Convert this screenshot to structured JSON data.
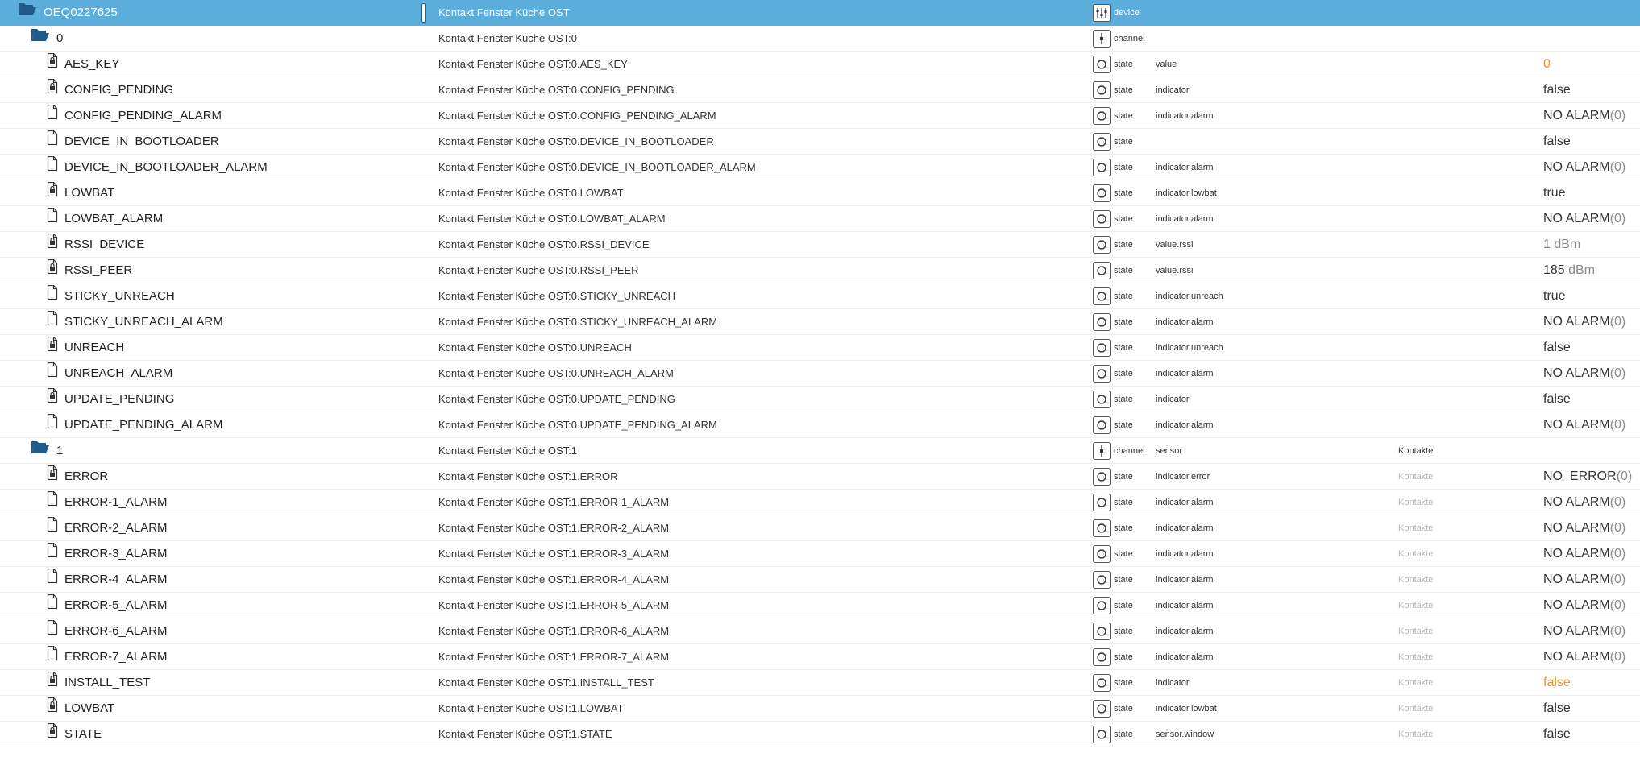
{
  "columns": {
    "sep": ""
  },
  "rows": [
    {
      "kind": "device",
      "level": 0,
      "icon": "folder-open-icon",
      "id": "OEQ0227625",
      "name": "Kontakt Fenster Küche OST",
      "type_icon": "device-icon",
      "type": "device",
      "role": "",
      "room": "",
      "value": "",
      "value_style": "",
      "selected": true
    },
    {
      "kind": "channel",
      "level": 1,
      "icon": "folder-open-icon",
      "id": "0",
      "name": "Kontakt Fenster Küche OST:0",
      "type_icon": "channel-icon",
      "type": "channel",
      "role": "",
      "room": "",
      "value": "",
      "value_style": ""
    },
    {
      "kind": "state",
      "level": 2,
      "icon": "file-lock-icon",
      "id": "AES_KEY",
      "name": "Kontakt Fenster Küche OST:0.AES_KEY",
      "type_icon": "state-icon",
      "type": "state",
      "role": "value",
      "room": "",
      "value": "0",
      "value_style": "orange"
    },
    {
      "kind": "state",
      "level": 2,
      "icon": "file-lock-icon",
      "id": "CONFIG_PENDING",
      "name": "Kontakt Fenster Küche OST:0.CONFIG_PENDING",
      "type_icon": "state-icon",
      "type": "state",
      "role": "indicator",
      "room": "",
      "value": "false",
      "value_style": ""
    },
    {
      "kind": "state",
      "level": 2,
      "icon": "file-icon",
      "id": "CONFIG_PENDING_ALARM",
      "name": "Kontakt Fenster Küche OST:0.CONFIG_PENDING_ALARM",
      "type_icon": "state-icon",
      "type": "state",
      "role": "indicator.alarm",
      "room": "",
      "value": "NO ALARM",
      "unit": "(0)",
      "value_style": ""
    },
    {
      "kind": "state",
      "level": 2,
      "icon": "file-icon",
      "id": "DEVICE_IN_BOOTLOADER",
      "name": "Kontakt Fenster Küche OST:0.DEVICE_IN_BOOTLOADER",
      "type_icon": "state-icon",
      "type": "state",
      "role": "",
      "room": "",
      "value": "false",
      "value_style": ""
    },
    {
      "kind": "state",
      "level": 2,
      "icon": "file-icon",
      "id": "DEVICE_IN_BOOTLOADER_ALARM",
      "name": "Kontakt Fenster Küche OST:0.DEVICE_IN_BOOTLOADER_ALARM",
      "type_icon": "state-icon",
      "type": "state",
      "role": "indicator.alarm",
      "room": "",
      "value": "NO ALARM",
      "unit": "(0)",
      "value_style": ""
    },
    {
      "kind": "state",
      "level": 2,
      "icon": "file-lock-icon",
      "id": "LOWBAT",
      "name": "Kontakt Fenster Küche OST:0.LOWBAT",
      "type_icon": "state-icon",
      "type": "state",
      "role": "indicator.lowbat",
      "room": "",
      "value": "true",
      "value_style": ""
    },
    {
      "kind": "state",
      "level": 2,
      "icon": "file-icon",
      "id": "LOWBAT_ALARM",
      "name": "Kontakt Fenster Küche OST:0.LOWBAT_ALARM",
      "type_icon": "state-icon",
      "type": "state",
      "role": "indicator.alarm",
      "room": "",
      "value": "NO ALARM",
      "unit": "(0)",
      "value_style": ""
    },
    {
      "kind": "state",
      "level": 2,
      "icon": "file-lock-icon",
      "id": "RSSI_DEVICE",
      "name": "Kontakt Fenster Küche OST:0.RSSI_DEVICE",
      "type_icon": "state-icon",
      "type": "state",
      "role": "value.rssi",
      "room": "",
      "value": "1",
      "unit": " dBm",
      "value_style": "grey"
    },
    {
      "kind": "state",
      "level": 2,
      "icon": "file-lock-icon",
      "id": "RSSI_PEER",
      "name": "Kontakt Fenster Küche OST:0.RSSI_PEER",
      "type_icon": "state-icon",
      "type": "state",
      "role": "value.rssi",
      "room": "",
      "value": "185",
      "unit": " dBm",
      "value_style": ""
    },
    {
      "kind": "state",
      "level": 2,
      "icon": "file-icon",
      "id": "STICKY_UNREACH",
      "name": "Kontakt Fenster Küche OST:0.STICKY_UNREACH",
      "type_icon": "state-icon",
      "type": "state",
      "role": "indicator.unreach",
      "room": "",
      "value": "true",
      "value_style": ""
    },
    {
      "kind": "state",
      "level": 2,
      "icon": "file-icon",
      "id": "STICKY_UNREACH_ALARM",
      "name": "Kontakt Fenster Küche OST:0.STICKY_UNREACH_ALARM",
      "type_icon": "state-icon",
      "type": "state",
      "role": "indicator.alarm",
      "room": "",
      "value": "NO ALARM",
      "unit": "(0)",
      "value_style": ""
    },
    {
      "kind": "state",
      "level": 2,
      "icon": "file-lock-icon",
      "id": "UNREACH",
      "name": "Kontakt Fenster Küche OST:0.UNREACH",
      "type_icon": "state-icon",
      "type": "state",
      "role": "indicator.unreach",
      "room": "",
      "value": "false",
      "value_style": ""
    },
    {
      "kind": "state",
      "level": 2,
      "icon": "file-icon",
      "id": "UNREACH_ALARM",
      "name": "Kontakt Fenster Küche OST:0.UNREACH_ALARM",
      "type_icon": "state-icon",
      "type": "state",
      "role": "indicator.alarm",
      "room": "",
      "value": "NO ALARM",
      "unit": "(0)",
      "value_style": ""
    },
    {
      "kind": "state",
      "level": 2,
      "icon": "file-lock-icon",
      "id": "UPDATE_PENDING",
      "name": "Kontakt Fenster Küche OST:0.UPDATE_PENDING",
      "type_icon": "state-icon",
      "type": "state",
      "role": "indicator",
      "room": "",
      "value": "false",
      "value_style": ""
    },
    {
      "kind": "state",
      "level": 2,
      "icon": "file-icon",
      "id": "UPDATE_PENDING_ALARM",
      "name": "Kontakt Fenster Küche OST:0.UPDATE_PENDING_ALARM",
      "type_icon": "state-icon",
      "type": "state",
      "role": "indicator.alarm",
      "room": "",
      "value": "NO ALARM",
      "unit": "(0)",
      "value_style": ""
    },
    {
      "kind": "channel",
      "level": 1,
      "icon": "folder-open-icon",
      "id": "1",
      "name": "Kontakt Fenster Küche OST:1",
      "type_icon": "channel-icon",
      "type": "channel",
      "role": "sensor",
      "room": "Kontakte",
      "room_strong": true,
      "value": "",
      "value_style": ""
    },
    {
      "kind": "state",
      "level": 2,
      "icon": "file-lock-icon",
      "id": "ERROR",
      "name": "Kontakt Fenster Küche OST:1.ERROR",
      "type_icon": "state-icon",
      "type": "state",
      "role": "indicator.error",
      "room": "Kontakte",
      "value": "NO_ERROR",
      "unit": "(0)",
      "value_style": ""
    },
    {
      "kind": "state",
      "level": 2,
      "icon": "file-icon",
      "id": "ERROR-1_ALARM",
      "name": "Kontakt Fenster Küche OST:1.ERROR-1_ALARM",
      "type_icon": "state-icon",
      "type": "state",
      "role": "indicator.alarm",
      "room": "Kontakte",
      "value": "NO ALARM",
      "unit": "(0)",
      "value_style": ""
    },
    {
      "kind": "state",
      "level": 2,
      "icon": "file-icon",
      "id": "ERROR-2_ALARM",
      "name": "Kontakt Fenster Küche OST:1.ERROR-2_ALARM",
      "type_icon": "state-icon",
      "type": "state",
      "role": "indicator.alarm",
      "room": "Kontakte",
      "value": "NO ALARM",
      "unit": "(0)",
      "value_style": ""
    },
    {
      "kind": "state",
      "level": 2,
      "icon": "file-icon",
      "id": "ERROR-3_ALARM",
      "name": "Kontakt Fenster Küche OST:1.ERROR-3_ALARM",
      "type_icon": "state-icon",
      "type": "state",
      "role": "indicator.alarm",
      "room": "Kontakte",
      "value": "NO ALARM",
      "unit": "(0)",
      "value_style": ""
    },
    {
      "kind": "state",
      "level": 2,
      "icon": "file-icon",
      "id": "ERROR-4_ALARM",
      "name": "Kontakt Fenster Küche OST:1.ERROR-4_ALARM",
      "type_icon": "state-icon",
      "type": "state",
      "role": "indicator.alarm",
      "room": "Kontakte",
      "value": "NO ALARM",
      "unit": "(0)",
      "value_style": ""
    },
    {
      "kind": "state",
      "level": 2,
      "icon": "file-icon",
      "id": "ERROR-5_ALARM",
      "name": "Kontakt Fenster Küche OST:1.ERROR-5_ALARM",
      "type_icon": "state-icon",
      "type": "state",
      "role": "indicator.alarm",
      "room": "Kontakte",
      "value": "NO ALARM",
      "unit": "(0)",
      "value_style": ""
    },
    {
      "kind": "state",
      "level": 2,
      "icon": "file-icon",
      "id": "ERROR-6_ALARM",
      "name": "Kontakt Fenster Küche OST:1.ERROR-6_ALARM",
      "type_icon": "state-icon",
      "type": "state",
      "role": "indicator.alarm",
      "room": "Kontakte",
      "value": "NO ALARM",
      "unit": "(0)",
      "value_style": ""
    },
    {
      "kind": "state",
      "level": 2,
      "icon": "file-icon",
      "id": "ERROR-7_ALARM",
      "name": "Kontakt Fenster Küche OST:1.ERROR-7_ALARM",
      "type_icon": "state-icon",
      "type": "state",
      "role": "indicator.alarm",
      "room": "Kontakte",
      "value": "NO ALARM",
      "unit": "(0)",
      "value_style": ""
    },
    {
      "kind": "state",
      "level": 2,
      "icon": "file-lock-icon",
      "id": "INSTALL_TEST",
      "name": "Kontakt Fenster Küche OST:1.INSTALL_TEST",
      "type_icon": "state-icon",
      "type": "state",
      "role": "indicator",
      "room": "Kontakte",
      "value": "false",
      "value_style": "orange"
    },
    {
      "kind": "state",
      "level": 2,
      "icon": "file-lock-icon",
      "id": "LOWBAT",
      "name": "Kontakt Fenster Küche OST:1.LOWBAT",
      "type_icon": "state-icon",
      "type": "state",
      "role": "indicator.lowbat",
      "room": "Kontakte",
      "value": "false",
      "value_style": ""
    },
    {
      "kind": "state",
      "level": 2,
      "icon": "file-lock-icon",
      "id": "STATE",
      "name": "Kontakt Fenster Küche OST:1.STATE",
      "type_icon": "state-icon",
      "type": "state",
      "role": "sensor.window",
      "room": "Kontakte",
      "value": "false",
      "value_style": ""
    }
  ],
  "colors": {
    "selected_bg": "#5baedc",
    "accent_orange": "#f0941d",
    "room_muted": "#b5b5b5"
  }
}
